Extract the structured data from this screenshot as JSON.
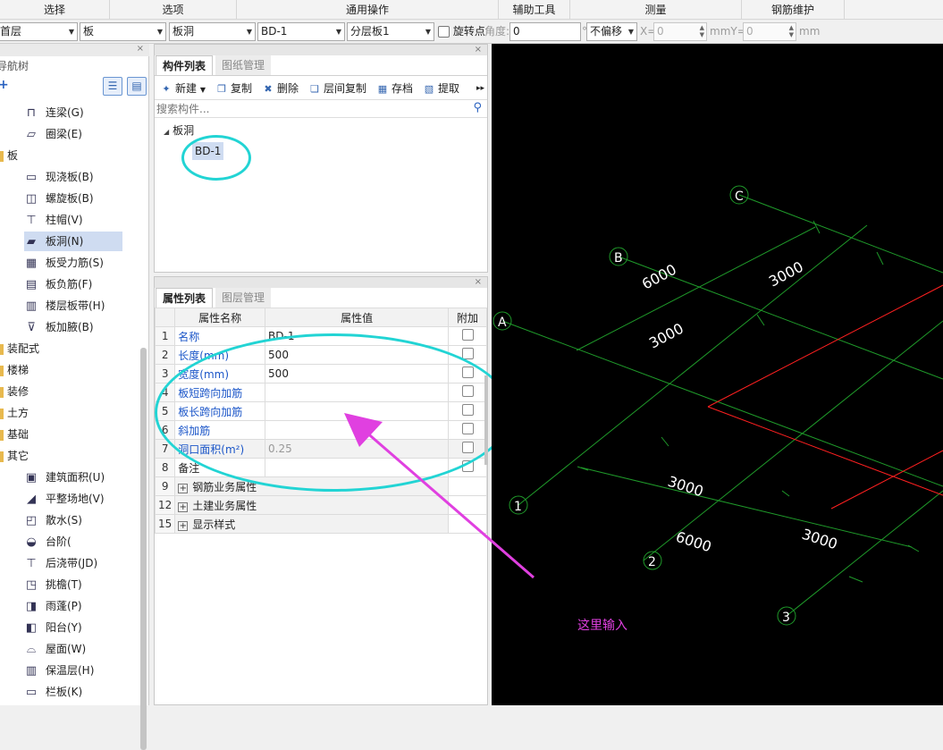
{
  "ribbon": {
    "groups": [
      "选择",
      "选项",
      "通用操作",
      "辅助工具",
      "测量",
      "钢筋维护"
    ]
  },
  "toolbar": {
    "floor": "首层",
    "category": "板",
    "type": "板洞",
    "element": "BD-1",
    "layer": "分层板1",
    "rotate_label": "旋转点",
    "angle_label": "角度:",
    "angle_value": "0",
    "degree": "°",
    "offset": "不偏移",
    "x_label": "X=",
    "x_value": "0",
    "mmy_label": "mmY=",
    "y_value": "0",
    "mm_label": "mm"
  },
  "nav": {
    "title": "导航树",
    "add": "+",
    "items": [
      {
        "label": "连梁(G)",
        "icon": "coupling-beam-icon",
        "glyph": "⊓"
      },
      {
        "label": "圈梁(E)",
        "icon": "ring-beam-icon",
        "glyph": "▱"
      },
      {
        "label": "现浇板(B)",
        "icon": "cast-slab-icon",
        "glyph": "▭"
      },
      {
        "label": "螺旋板(B)",
        "icon": "spiral-slab-icon",
        "glyph": "◫"
      },
      {
        "label": "柱帽(V)",
        "icon": "column-cap-icon",
        "glyph": "⊤"
      },
      {
        "label": "板洞(N)",
        "icon": "slab-hole-icon",
        "glyph": "▰"
      },
      {
        "label": "板受力筋(S)",
        "icon": "slab-rebar-icon",
        "glyph": "▦"
      },
      {
        "label": "板负筋(F)",
        "icon": "slab-neg-rebar-icon",
        "glyph": "▤"
      },
      {
        "label": "楼层板带(H)",
        "icon": "slab-strip-icon",
        "glyph": "▥"
      },
      {
        "label": "板加腋(B)",
        "icon": "slab-haunch-icon",
        "glyph": "⊽"
      },
      {
        "label": "建筑面积(U)",
        "icon": "building-area-icon",
        "glyph": "▣"
      },
      {
        "label": "平整场地(V)",
        "icon": "site-leveling-icon",
        "glyph": "◢"
      },
      {
        "label": "散水(S)",
        "icon": "apron-icon",
        "glyph": "◰"
      },
      {
        "label": "台阶(",
        "icon": "step-icon",
        "glyph": "◒"
      },
      {
        "label": "后浇带(JD)",
        "icon": "post-pour-strip-icon",
        "glyph": "⊤"
      },
      {
        "label": "挑檐(T)",
        "icon": "cornice-icon",
        "glyph": "◳"
      },
      {
        "label": "雨蓬(P)",
        "icon": "canopy-icon",
        "glyph": "◨"
      },
      {
        "label": "阳台(Y)",
        "icon": "balcony-icon",
        "glyph": "◧"
      },
      {
        "label": "屋面(W)",
        "icon": "roof-icon",
        "glyph": "⌓"
      },
      {
        "label": "保温层(H)",
        "icon": "insulation-icon",
        "glyph": "▥"
      },
      {
        "label": "栏板(K)",
        "icon": "parapet-icon",
        "glyph": "▭"
      }
    ],
    "folders": [
      "板",
      "装配式",
      "楼梯",
      "装修",
      "土方",
      "基础",
      "其它"
    ]
  },
  "component_panel": {
    "tab_active": "构件列表",
    "tab_inactive": "图纸管理",
    "buttons": {
      "new": "新建",
      "copy": "复制",
      "delete": "删除",
      "layer_copy": "层间复制",
      "save": "存档",
      "extract": "提取"
    },
    "search_placeholder": "搜索构件...",
    "tree_group": "板洞",
    "tree_item": "BD-1"
  },
  "property_panel": {
    "tab_active": "属性列表",
    "tab_inactive": "图层管理",
    "headers": {
      "name": "属性名称",
      "value": "属性值",
      "extra": "附加"
    },
    "rows": [
      {
        "no": "1",
        "name": "名称",
        "value": "BD-1"
      },
      {
        "no": "2",
        "name": "长度(mm)",
        "value": "500"
      },
      {
        "no": "3",
        "name": "宽度(mm)",
        "value": "500"
      },
      {
        "no": "4",
        "name": "板短跨向加筋",
        "value": ""
      },
      {
        "no": "5",
        "name": "板长跨向加筋",
        "value": ""
      },
      {
        "no": "6",
        "name": "斜加筋",
        "value": ""
      },
      {
        "no": "7",
        "name": "洞口面积(m²)",
        "value": "0.25"
      },
      {
        "no": "8",
        "name": "备注",
        "value": ""
      }
    ],
    "groups": [
      {
        "no": "9",
        "name": "钢筋业务属性"
      },
      {
        "no": "12",
        "name": "土建业务属性"
      },
      {
        "no": "15",
        "name": "显示样式"
      }
    ]
  },
  "canvas": {
    "axes": [
      "C",
      "B",
      "A",
      "1",
      "2",
      "3"
    ],
    "dims": [
      "6000",
      "3000",
      "3000",
      "3000",
      "6000",
      "3000"
    ],
    "annotation": "这里输入",
    "colors": {
      "grid": "#1f9a2a",
      "red": "#ff2020",
      "annotation": "#e040e0",
      "circle": "#22d4d4"
    }
  }
}
